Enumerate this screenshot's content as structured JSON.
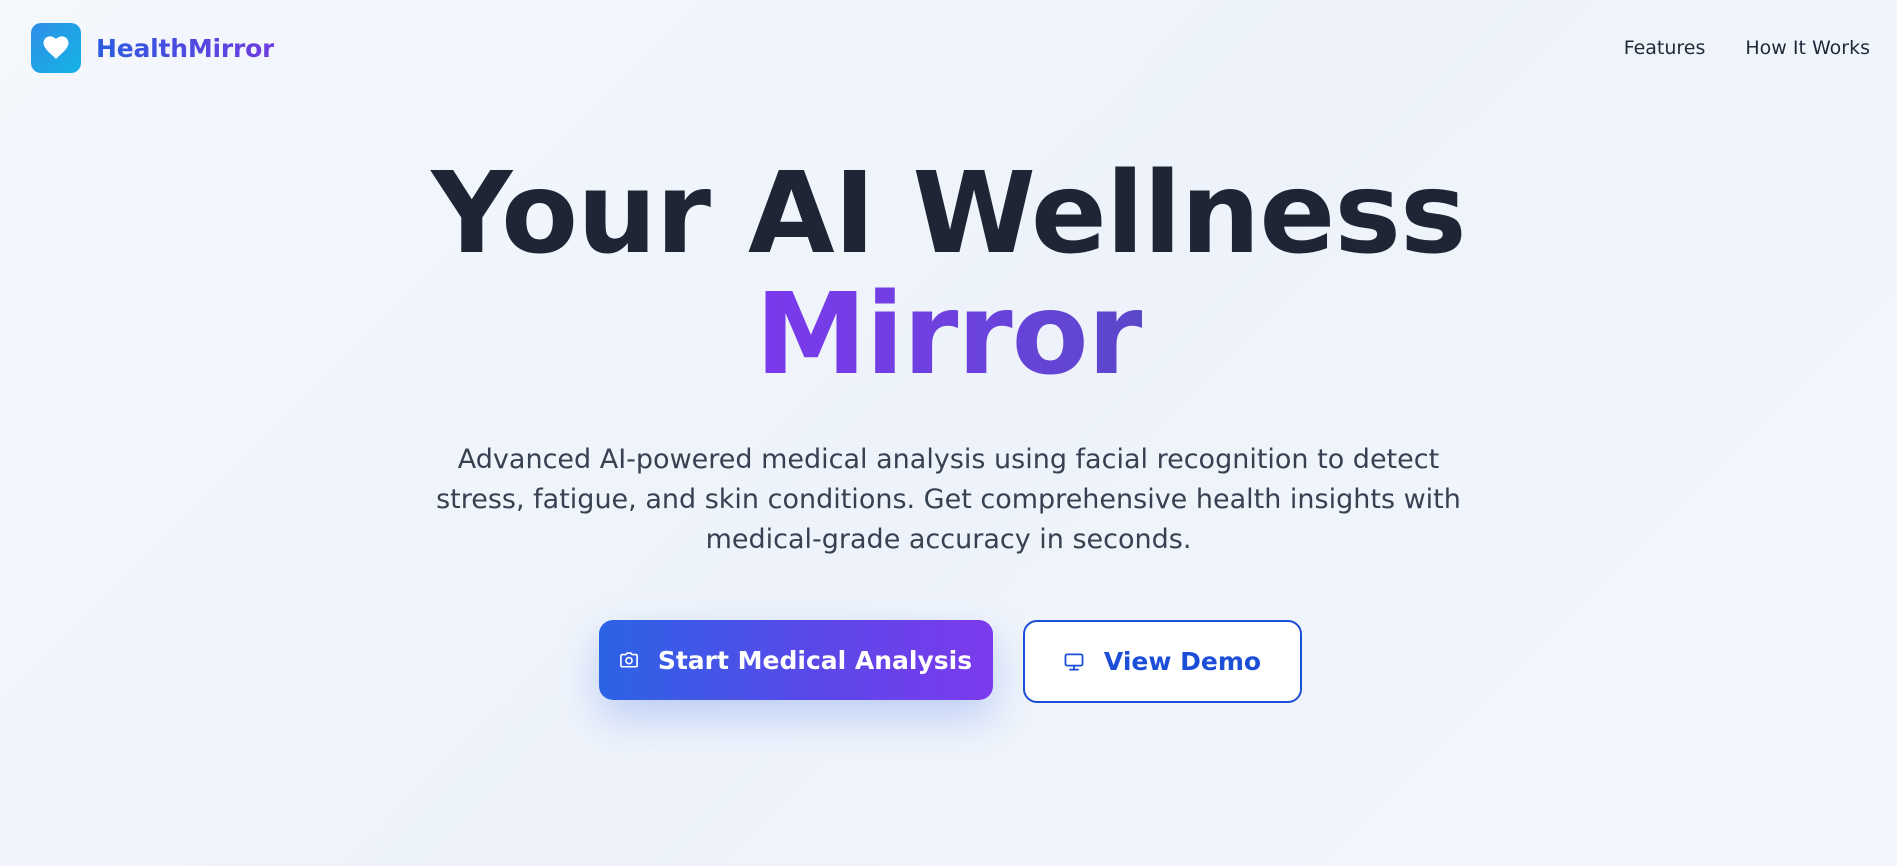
{
  "brand": {
    "name": "HealthMirror",
    "logo_icon": "heart-icon",
    "gradient_from": "#2b5de0",
    "gradient_to": "#6f3be0"
  },
  "nav": {
    "items": [
      {
        "label": "Features"
      },
      {
        "label": "How It Works"
      }
    ]
  },
  "hero": {
    "title_line1": "Your AI Wellness",
    "title_line2": "Mirror",
    "subtitle": "Advanced AI-powered medical analysis using facial recognition to detect stress, fatigue, and skin conditions. Get comprehensive health insights with medical-grade accuracy in seconds."
  },
  "actions": {
    "primary": {
      "label": "Start Medical Analysis",
      "icon": "camera-icon"
    },
    "secondary": {
      "label": "View Demo",
      "icon": "monitor-icon"
    }
  },
  "colors": {
    "title": "#1e2636",
    "accent_purple": "#7b39ec",
    "accent_blue": "#1d4ed8"
  }
}
